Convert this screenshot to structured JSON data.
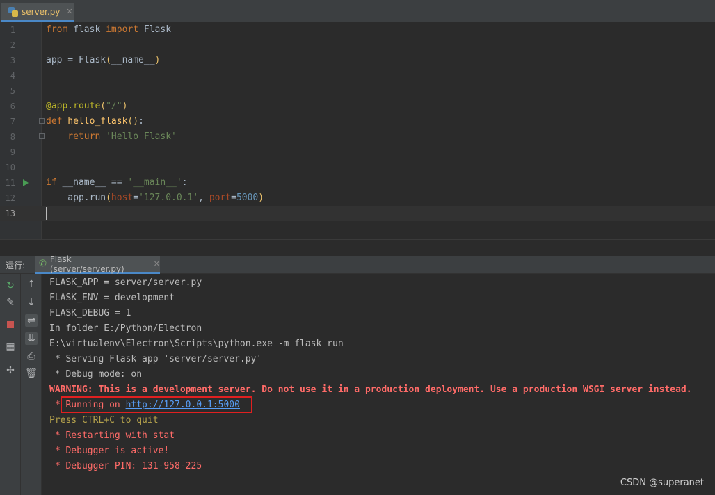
{
  "editor_tab": {
    "filename": "server.py",
    "close": "✕"
  },
  "editor": {
    "lines": [
      {
        "num": "1"
      },
      {
        "num": "2"
      },
      {
        "num": "3"
      },
      {
        "num": "4"
      },
      {
        "num": "5"
      },
      {
        "num": "6"
      },
      {
        "num": "7"
      },
      {
        "num": "8"
      },
      {
        "num": "9"
      },
      {
        "num": "10"
      },
      {
        "num": "11"
      },
      {
        "num": "12"
      },
      {
        "num": "13"
      }
    ],
    "tokens": {
      "l1_from": "from",
      "l1_mod": " flask ",
      "l1_import": "import",
      "l1_name": " Flask",
      "l3_a": "app = Flask",
      "l3_p1": "(",
      "l3_arg": "__name__",
      "l3_p2": ")",
      "l6_deco": "@app.route",
      "l6_p1": "(",
      "l6_str": "\"/\"",
      "l6_p2": ")",
      "l7_def": "def",
      "l7_fn": " hello_flask",
      "l7_paren": "()",
      "l7_colon": ":",
      "l8_ret": "    return",
      "l8_str": " 'Hello Flask'",
      "l11_if": "if",
      "l11_a": " __name__ == ",
      "l11_str": "'__main__'",
      "l11_colon": ":",
      "l12_a": "    app.run",
      "l12_p1": "(",
      "l12_host": "host",
      "l12_eq1": "=",
      "l12_hval": "'127.0.0.1'",
      "l12_c": ", ",
      "l12_port": "port",
      "l12_eq2": "=",
      "l12_pval": "5000",
      "l12_p2": ")"
    }
  },
  "run_panel": {
    "label": "运行:",
    "tab_label": "Flask (server/server.py)",
    "close": "✕"
  },
  "console": {
    "lines": [
      "FLASK_APP = server/server.py",
      "FLASK_ENV = development",
      "FLASK_DEBUG = 1",
      "In folder E:/Python/Electron",
      "E:\\virtualenv\\Electron\\Scripts\\python.exe -m flask run",
      " * Serving Flask app 'server/server.py'",
      " * Debug mode: on",
      "WARNING: This is a development server. Do not use it in a production deployment. Use a production WSGI server instead.",
      " * Running on ",
      "http://127.0.0.1:5000",
      "Press CTRL+C to quit",
      " * Restarting with stat",
      " * Debugger is active!",
      " * Debugger PIN: 131-958-225"
    ]
  },
  "toolbar_icons": {
    "rerun": "rerun-icon",
    "settings": "wrench-icon",
    "stop": "stop-icon",
    "layout": "layout-icon",
    "pin": "pin-icon",
    "up": "arrow-up-icon",
    "down": "arrow-down-icon",
    "wrap": "soft-wrap-icon",
    "scroll_end": "scroll-to-end-icon",
    "print": "print-icon",
    "clear": "trash-icon"
  },
  "colors": {
    "accent_tab": "#4a88c7",
    "error_text": "#ff6b68",
    "link": "#589df6",
    "highlight_box": "#e02020"
  },
  "watermark": "CSDN @superanet"
}
